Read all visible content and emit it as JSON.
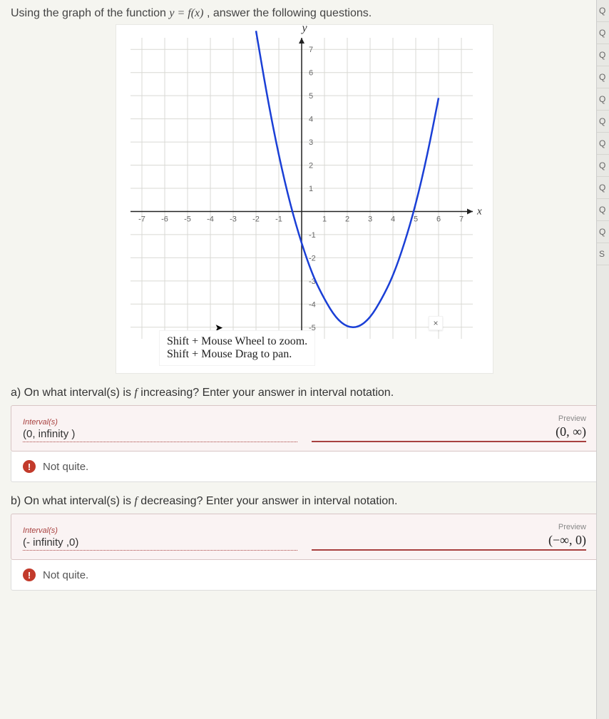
{
  "prompt": {
    "prefix": "Using the graph of the function ",
    "func": "y = f(x)",
    "suffix": ", answer the following questions."
  },
  "chart_data": {
    "type": "line",
    "title": "",
    "x_axis_label": "x",
    "y_axis_label": "y",
    "x_ticks": [
      -7,
      -6,
      -5,
      -4,
      -3,
      -2,
      -1,
      1,
      2,
      3,
      4,
      5,
      6,
      7
    ],
    "y_ticks": [
      -5,
      -4,
      -3,
      -2,
      -1,
      1,
      2,
      3,
      4,
      5,
      6,
      7
    ],
    "xlim": [
      -7.5,
      7.5
    ],
    "ylim": [
      -5.5,
      7.5
    ],
    "series": [
      {
        "name": "f(x)",
        "x": [
          -2,
          -1.5,
          -1,
          -0.5,
          0,
          0.5,
          1,
          1.5,
          2,
          2.5,
          3,
          3.5,
          4,
          4.5,
          5,
          5.5,
          6
        ],
        "y": [
          7.8,
          4.9,
          2.4,
          0.3,
          -1.4,
          -2.8,
          -3.8,
          -4.6,
          -5,
          -5,
          -4.6,
          -3.8,
          -2.8,
          -1.4,
          0.3,
          2.4,
          4.9
        ]
      }
    ],
    "hint_lines": [
      "Shift + Mouse Wheel to zoom.",
      "Shift + Mouse Drag to pan."
    ],
    "close_button": "×"
  },
  "parts": {
    "a": {
      "label": "a) On what interval(s) is f increasing? Enter your answer in interval notation.",
      "field_title": "Interval(s)",
      "value": "(0, infinity )",
      "preview_label": "Preview",
      "preview_value": "(0, ∞)",
      "feedback": "Not quite."
    },
    "b": {
      "label": "b) On what interval(s) is f decreasing? Enter your answer in interval notation.",
      "field_title": "Interval(s)",
      "value": "(- infinity ,0)",
      "preview_label": "Preview",
      "preview_value": "(−∞, 0)",
      "feedback": "Not quite."
    }
  },
  "right_rail": [
    "Q",
    "Q",
    "Q",
    "Q",
    "Q",
    "Q",
    "Q",
    "Q",
    "Q",
    "Q",
    "Q",
    "S"
  ]
}
